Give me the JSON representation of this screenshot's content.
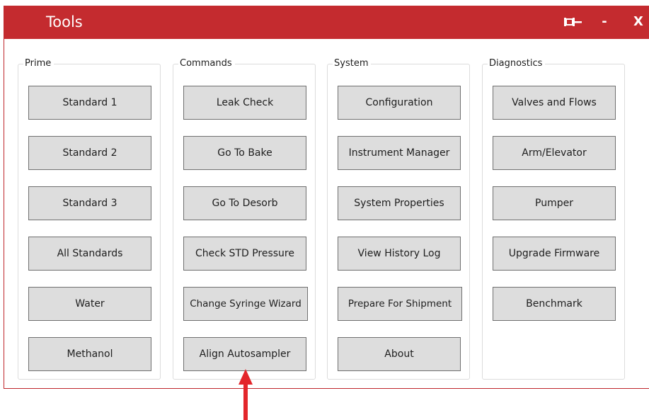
{
  "window": {
    "title": "Tools",
    "controls": {
      "minimize": "-",
      "close": "X"
    },
    "title_bar_color": "#c42b2f"
  },
  "groups": [
    {
      "label": "Prime",
      "buttons": [
        "Standard 1",
        "Standard 2",
        "Standard 3",
        "All Standards",
        "Water",
        "Methanol"
      ]
    },
    {
      "label": "Commands",
      "buttons": [
        "Leak Check",
        "Go To Bake",
        "Go To Desorb",
        "Check STD Pressure",
        "Change Syringe Wizard",
        "Align Autosampler"
      ]
    },
    {
      "label": "System",
      "buttons": [
        "Configuration",
        "Instrument Manager",
        "System Properties",
        "View History Log",
        "Prepare For Shipment",
        "About"
      ]
    },
    {
      "label": "Diagnostics",
      "buttons": [
        "Valves and Flows",
        "Arm/Elevator",
        "Pumper",
        "Upgrade Firmware",
        "Benchmark"
      ]
    }
  ],
  "annotation": {
    "arrow_color": "#e3262b",
    "icon": "up-arrow-icon"
  }
}
